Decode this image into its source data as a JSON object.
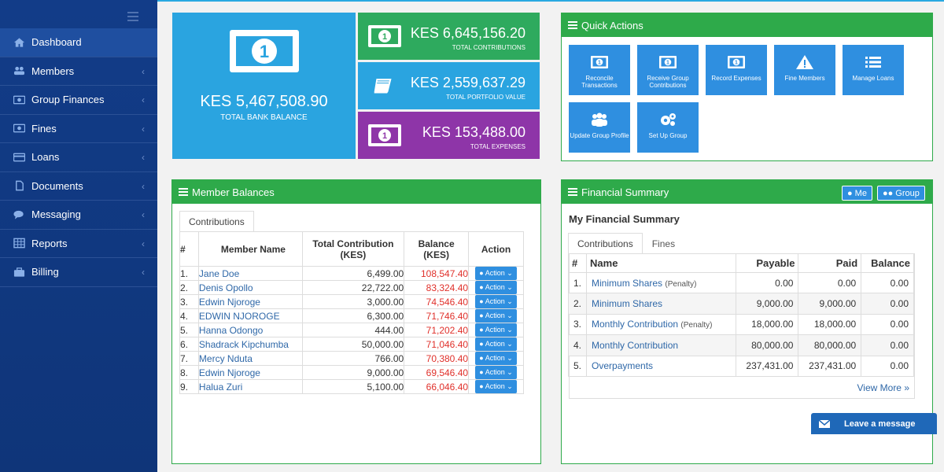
{
  "sidebar": {
    "items": [
      {
        "label": "Dashboard",
        "icon": "home-icon",
        "arrow": ""
      },
      {
        "label": "Members",
        "icon": "users-icon",
        "arrow": "‹"
      },
      {
        "label": "Group Finances",
        "icon": "money-icon",
        "arrow": "‹"
      },
      {
        "label": "Fines",
        "icon": "money-icon",
        "arrow": "‹"
      },
      {
        "label": "Loans",
        "icon": "credit-card-icon",
        "arrow": "‹"
      },
      {
        "label": "Documents",
        "icon": "file-icon",
        "arrow": "‹"
      },
      {
        "label": "Messaging",
        "icon": "comments-icon",
        "arrow": "‹"
      },
      {
        "label": "Reports",
        "icon": "table-icon",
        "arrow": "‹"
      },
      {
        "label": "Billing",
        "icon": "briefcase-icon",
        "arrow": "‹"
      }
    ]
  },
  "tiles": {
    "bank": {
      "value": "KES 5,467,508.90",
      "caption": "TOTAL BANK BALANCE",
      "color": "#2aa4e0"
    },
    "contributions": {
      "value": "KES 6,645,156.20",
      "caption": "TOTAL CONTRIBUTIONS",
      "color": "#2eaa5e"
    },
    "portfolio": {
      "value": "KES 2,559,637.29",
      "caption": "TOTAL PORTFOLIO VALUE",
      "color": "#2aa4e0"
    },
    "expenses": {
      "value": "KES 153,488.00",
      "caption": "TOTAL EXPENSES",
      "color": "#8e35a8"
    }
  },
  "quick_actions": {
    "title": "Quick Actions",
    "buttons": [
      {
        "label": "Reconcile Transactions",
        "icon": "money-icon"
      },
      {
        "label": "Receive Group Contributions",
        "icon": "money-icon"
      },
      {
        "label": "Record Expenses",
        "icon": "money-icon"
      },
      {
        "label": "Fine Members",
        "icon": "warning-icon"
      },
      {
        "label": "Manage Loans",
        "icon": "list-icon"
      },
      {
        "label": "Update Group Profile",
        "icon": "users-icon"
      },
      {
        "label": "Set Up Group",
        "icon": "cogs-icon"
      }
    ]
  },
  "member_balances": {
    "title": "Member Balances",
    "tab": "Contributions",
    "columns": [
      "#",
      "Member Name",
      "Total Contribution (KES)",
      "Balance (KES)",
      "Action"
    ],
    "rows": [
      {
        "n": "1.",
        "name": "Jane Doe",
        "contribution": "6,499.00",
        "balance": "108,547.40",
        "action": "Action"
      },
      {
        "n": "2.",
        "name": "Denis Opollo",
        "contribution": "22,722.00",
        "balance": "83,324.40",
        "action": "Action"
      },
      {
        "n": "3.",
        "name": "Edwin Njoroge",
        "contribution": "3,000.00",
        "balance": "74,546.40",
        "action": "Action"
      },
      {
        "n": "4.",
        "name": "EDWIN NJOROGE",
        "contribution": "6,300.00",
        "balance": "71,746.40",
        "action": "Action"
      },
      {
        "n": "5.",
        "name": "Hanna Odongo",
        "contribution": "444.00",
        "balance": "71,202.40",
        "action": "Action"
      },
      {
        "n": "6.",
        "name": "Shadrack Kipchumba",
        "contribution": "50,000.00",
        "balance": "71,046.40",
        "action": "Action"
      },
      {
        "n": "7.",
        "name": "Mercy Nduta",
        "contribution": "766.00",
        "balance": "70,380.40",
        "action": "Action"
      },
      {
        "n": "8.",
        "name": "Edwin Njoroge",
        "contribution": "9,000.00",
        "balance": "69,546.40",
        "action": "Action"
      },
      {
        "n": "9.",
        "name": "Halua Zuri",
        "contribution": "5,100.00",
        "balance": "66,046.40",
        "action": "Action"
      }
    ]
  },
  "financial_summary": {
    "title": "Financial Summary",
    "me_button": "Me",
    "group_button": "Group",
    "subtitle": "My Financial Summary",
    "tabs": [
      "Contributions",
      "Fines"
    ],
    "columns": [
      "#",
      "Name",
      "Payable",
      "Paid",
      "Balance"
    ],
    "rows": [
      {
        "n": "1.",
        "name": "Minimum Shares",
        "note": "(Penalty)",
        "payable": "0.00",
        "paid": "0.00",
        "balance": "0.00"
      },
      {
        "n": "2.",
        "name": "Minimum Shares",
        "note": "",
        "payable": "9,000.00",
        "paid": "9,000.00",
        "balance": "0.00"
      },
      {
        "n": "3.",
        "name": "Monthly Contribution",
        "note": "(Penalty)",
        "payable": "18,000.00",
        "paid": "18,000.00",
        "balance": "0.00"
      },
      {
        "n": "4.",
        "name": "Monthly Contribution",
        "note": "",
        "payable": "80,000.00",
        "paid": "80,000.00",
        "balance": "0.00"
      },
      {
        "n": "5.",
        "name": "Overpayments",
        "note": "",
        "payable": "237,431.00",
        "paid": "237,431.00",
        "balance": "0.00"
      }
    ],
    "view_more": "View More »"
  },
  "chat": {
    "label": "Leave a message",
    "icon": "envelope-icon"
  }
}
